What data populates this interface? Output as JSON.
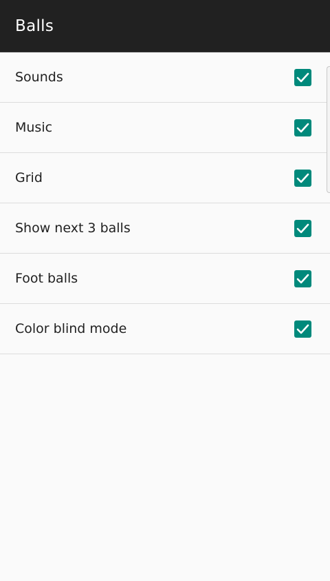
{
  "app_bar": {
    "title": "Balls"
  },
  "settings": [
    {
      "label": "Sounds",
      "checked": true
    },
    {
      "label": "Music",
      "checked": true
    },
    {
      "label": "Grid",
      "checked": true
    },
    {
      "label": "Show next 3 balls",
      "checked": true
    },
    {
      "label": "Foot balls",
      "checked": true
    },
    {
      "label": "Color blind mode",
      "checked": true
    }
  ],
  "colors": {
    "app_bar_bg": "#212121",
    "checkbox_accent": "#00897b",
    "background": "#fafafa"
  }
}
